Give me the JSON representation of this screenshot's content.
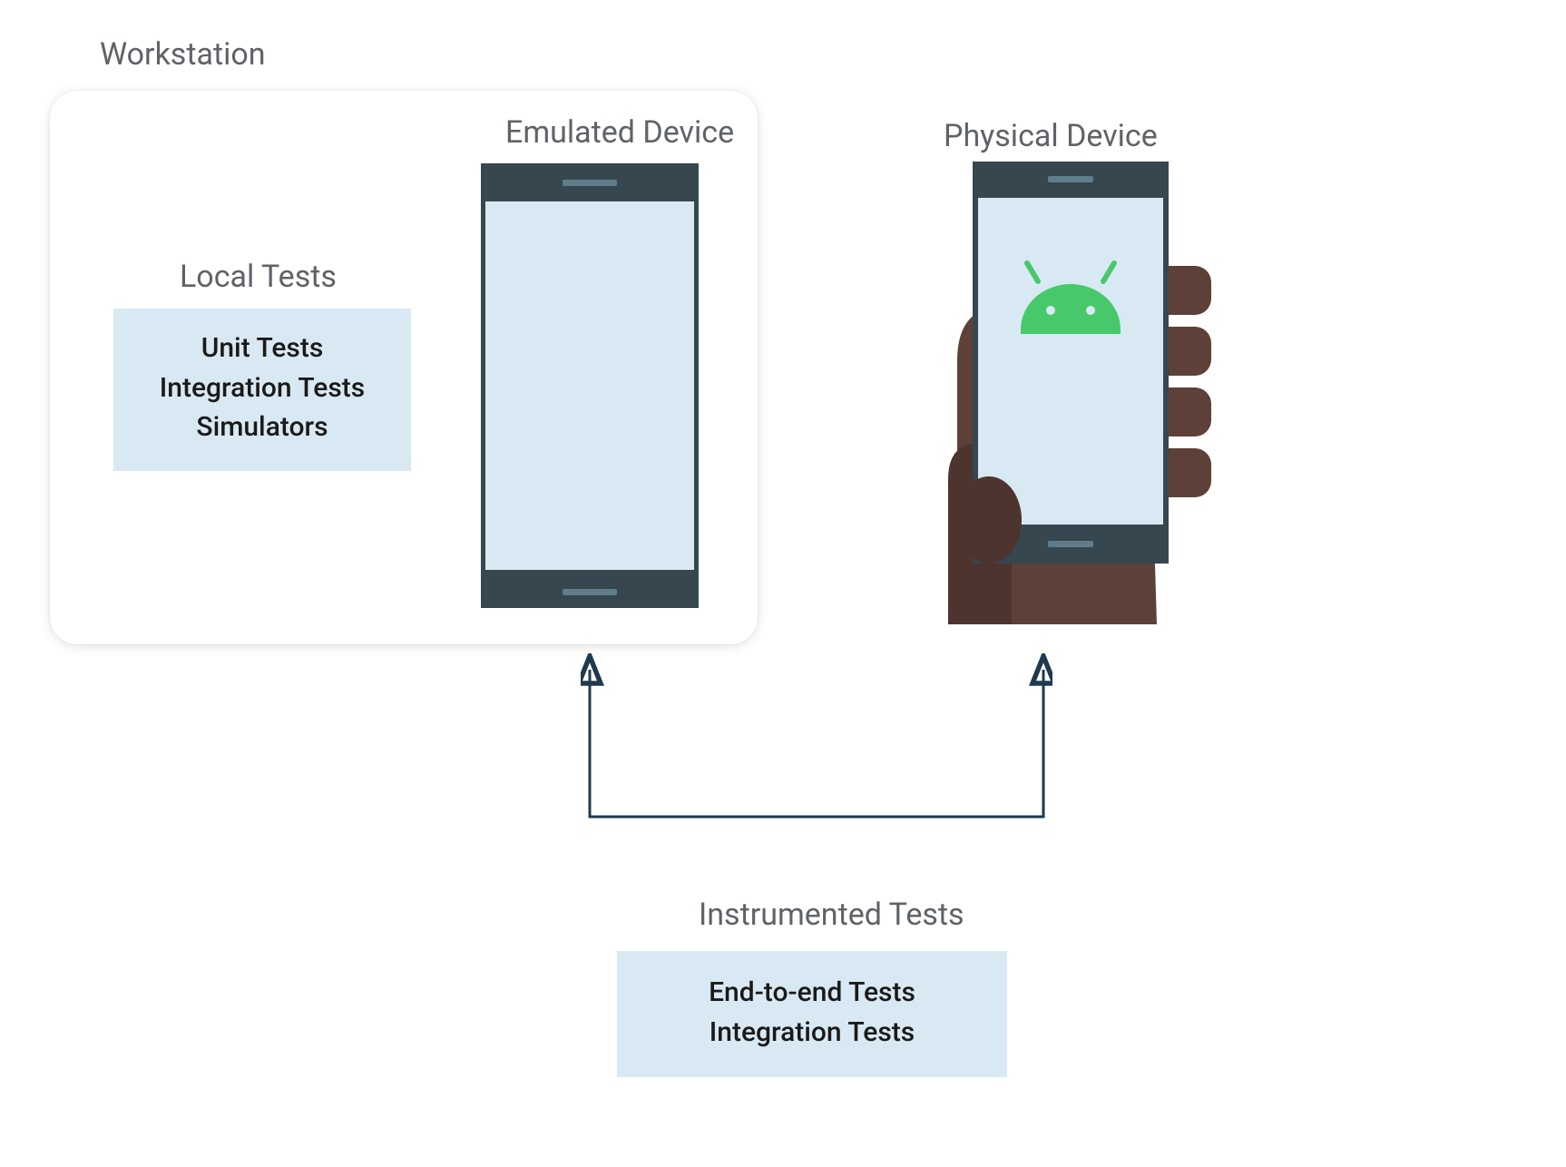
{
  "workstation": {
    "label": "Workstation",
    "local_tests": {
      "heading": "Local Tests",
      "items": [
        "Unit Tests",
        "Integration Tests",
        "Simulators"
      ]
    },
    "emulated_label": "Emulated Device"
  },
  "physical_label": "Physical Device",
  "instrumented": {
    "heading": "Instrumented Tests",
    "items": [
      "End-to-end Tests",
      "Integration Tests"
    ]
  },
  "colors": {
    "card_bg": "#ffffff",
    "box_bg": "#d9e9f3",
    "text_muted": "#5f6368",
    "phone_frame": "#37474f",
    "android_green": "#3ddc84",
    "hand": "#5d4037",
    "hand_dark": "#4e342e",
    "arrow": "#1f3a4d"
  }
}
